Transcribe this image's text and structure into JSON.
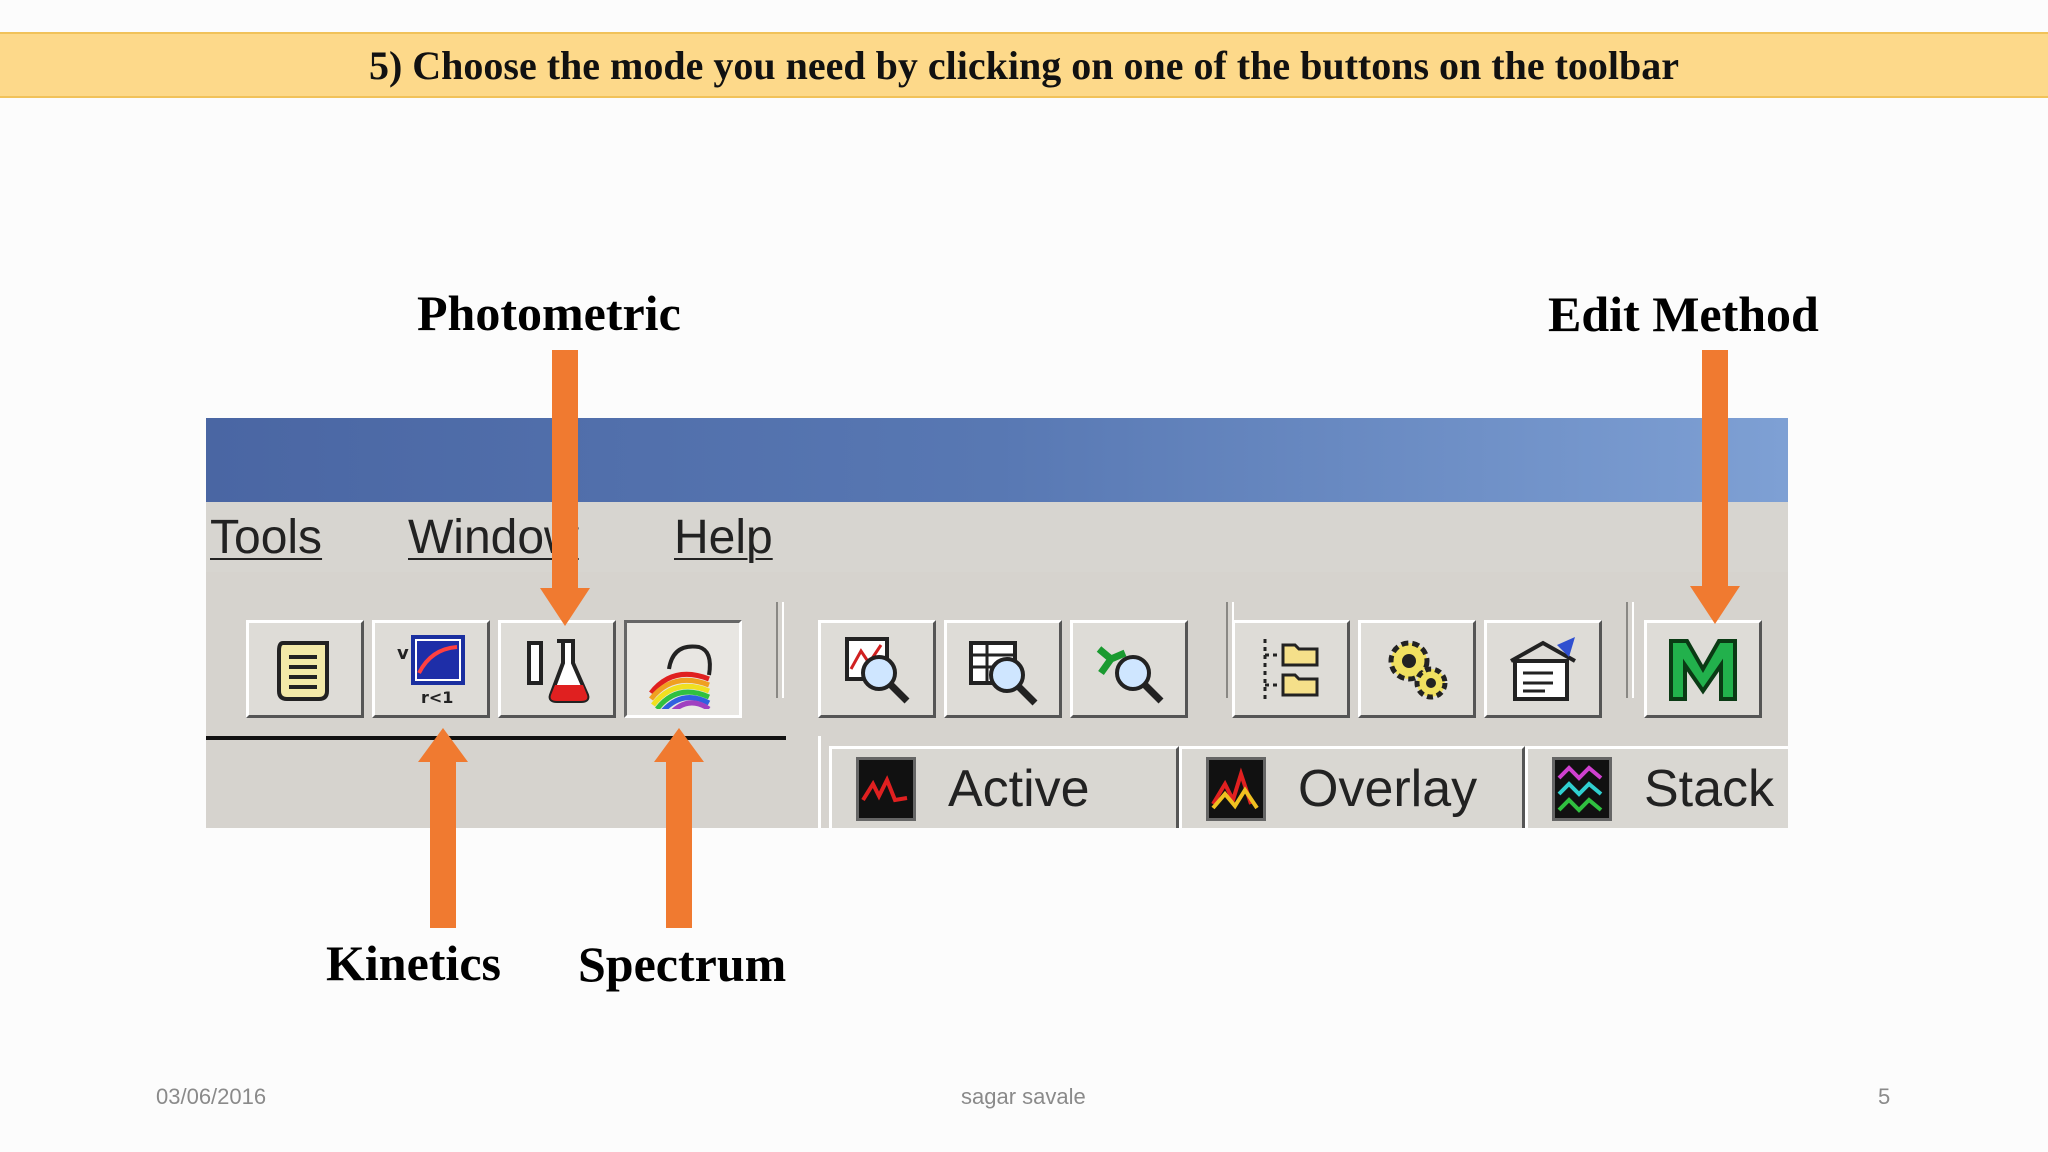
{
  "banner": {
    "title": "5) Choose the mode you need by clicking on one of the buttons on the toolbar"
  },
  "callouts": {
    "photometric": "Photometric",
    "edit_method": "Edit Method",
    "kinetics": "Kinetics",
    "spectrum": "Spectrum"
  },
  "menu": {
    "tools": "Tools",
    "window": "Window",
    "help": "Help"
  },
  "tabs": [
    {
      "label": "Active",
      "icon": "active-graph-icon"
    },
    {
      "label": "Overlay",
      "icon": "overlay-graph-icon"
    },
    {
      "label": "Stack",
      "icon": "stack-graph-icon"
    }
  ],
  "toolbar_icons": [
    "scroll-icon",
    "kinetics-icon",
    "photometric-flask-icon",
    "spectrum-rainbow-icon",
    "zoom-graph-icon",
    "zoom-table-icon",
    "zoom-molecule-icon",
    "folders-tree-icon",
    "gear-settings-icon",
    "edit-report-icon",
    "method-m-icon"
  ],
  "colors": {
    "arrow": "#f07a30",
    "banner": "#fdd98a",
    "method_green": "#22b14c"
  },
  "footer": {
    "date": "03/06/2016",
    "author": "sagar savale",
    "page": "5"
  }
}
